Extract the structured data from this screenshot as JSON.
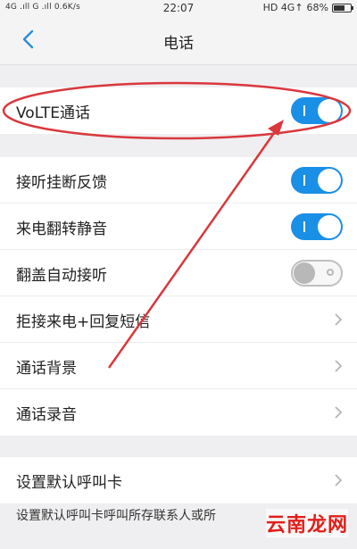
{
  "status_bar": {
    "left": "4G .ıll G .ıll 0.6K/s",
    "time": "22:07",
    "network": "HD 4G↑",
    "battery": "68%"
  },
  "header": {
    "title": "电话"
  },
  "volte": {
    "label": "VoLTE通话",
    "enabled": true
  },
  "settings": [
    {
      "label": "接听挂断反馈",
      "type": "toggle",
      "enabled": true
    },
    {
      "label": "来电翻转静音",
      "type": "toggle",
      "enabled": true
    },
    {
      "label": "翻盖自动接听",
      "type": "toggle",
      "enabled": false
    },
    {
      "label": "拒接来电+回复短信",
      "type": "link"
    },
    {
      "label": "通话背景",
      "type": "link"
    },
    {
      "label": "通话录音",
      "type": "link"
    }
  ],
  "default_card": {
    "label": "设置默认呼叫卡"
  },
  "footnote": "设置默认呼叫卡呼叫所存联系人或所",
  "watermark": "云南龙网",
  "colors": {
    "accent": "#1a8fe6",
    "annotation": "#d9383d",
    "watermark": "#e0201b"
  }
}
